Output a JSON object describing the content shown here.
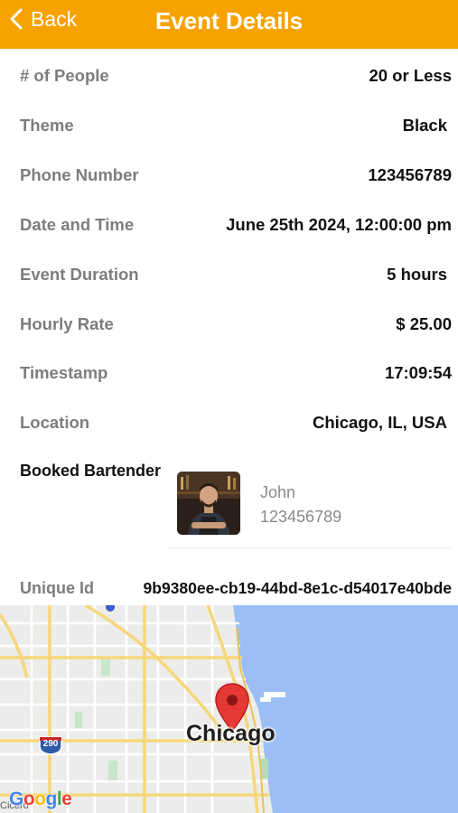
{
  "header": {
    "back_label": "Back",
    "title": "Event Details"
  },
  "details": [
    {
      "label": "# of People",
      "value": "20 or Less"
    },
    {
      "label": "Theme",
      "value": "Black"
    },
    {
      "label": "Phone Number",
      "value": "123456789"
    },
    {
      "label": "Date and Time",
      "value": "June 25th 2024, 12:00:00 pm"
    },
    {
      "label": "Event Duration",
      "value": "5 hours"
    },
    {
      "label": "Hourly Rate",
      "value": "$ 25.00"
    },
    {
      "label": "Timestamp",
      "value": "17:09:54"
    },
    {
      "label": "Location",
      "value": "Chicago, IL, USA"
    }
  ],
  "booked": {
    "label": "Booked Bartender",
    "name": "John",
    "phone": "123456789"
  },
  "unique_id": {
    "label": "Unique Id",
    "value": "9b9380ee-cb19-44bd-8e1c-d54017e40bde"
  },
  "map": {
    "city_label": "Chicago",
    "highway_shield": "290",
    "neighborhood": "Cicero",
    "attribution": "Google",
    "pin_icon": "map-pin-icon"
  },
  "colors": {
    "header": "#f8a200",
    "label_gray": "#7d7d7d",
    "water": "#9bbff4",
    "pin_red": "#e53935"
  }
}
